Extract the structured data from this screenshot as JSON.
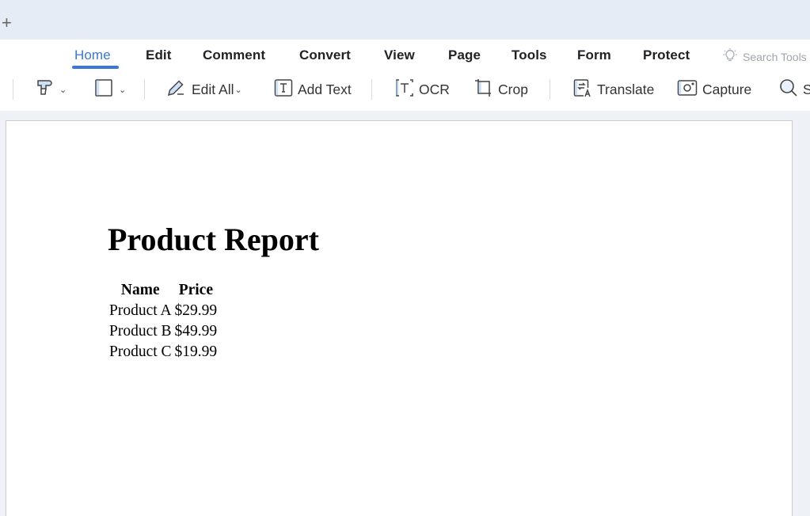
{
  "tabbar": {
    "new_tab_label": "+"
  },
  "menu": {
    "tabs": [
      {
        "label": "Home",
        "active": true
      },
      {
        "label": "Edit",
        "active": false
      },
      {
        "label": "Comment",
        "active": false
      },
      {
        "label": "Convert",
        "active": false
      },
      {
        "label": "View",
        "active": false
      },
      {
        "label": "Page",
        "active": false
      },
      {
        "label": "Tools",
        "active": false
      },
      {
        "label": "Form",
        "active": false
      },
      {
        "label": "Protect",
        "active": false
      }
    ],
    "search_tools_placeholder": "Search Tools",
    "accent_color": "#3a78d8"
  },
  "toolbar": {
    "items": [
      {
        "label": "",
        "icon": "format-painter-icon",
        "has_dropdown": true
      },
      {
        "label": "",
        "icon": "rectangle-icon",
        "has_dropdown": true
      },
      {
        "label": "Edit All",
        "icon": "edit-pen-icon",
        "has_dropdown": true
      },
      {
        "label": "Add Text",
        "icon": "add-text-icon",
        "has_dropdown": false
      },
      {
        "label": "OCR",
        "icon": "ocr-icon",
        "has_dropdown": false
      },
      {
        "label": "Crop",
        "icon": "crop-icon",
        "has_dropdown": false
      },
      {
        "label": "Translate",
        "icon": "translate-icon",
        "has_dropdown": false
      },
      {
        "label": "Capture",
        "icon": "capture-icon",
        "has_dropdown": false
      },
      {
        "label": "S",
        "icon": "search-icon",
        "has_dropdown": false
      }
    ],
    "caret": "⌄"
  },
  "document": {
    "title": "Product Report",
    "table": {
      "headers": [
        "Name",
        "Price"
      ],
      "rows": [
        [
          "Product A",
          "$29.99"
        ],
        [
          "Product B",
          "$49.99"
        ],
        [
          "Product C",
          "$19.99"
        ]
      ]
    }
  }
}
